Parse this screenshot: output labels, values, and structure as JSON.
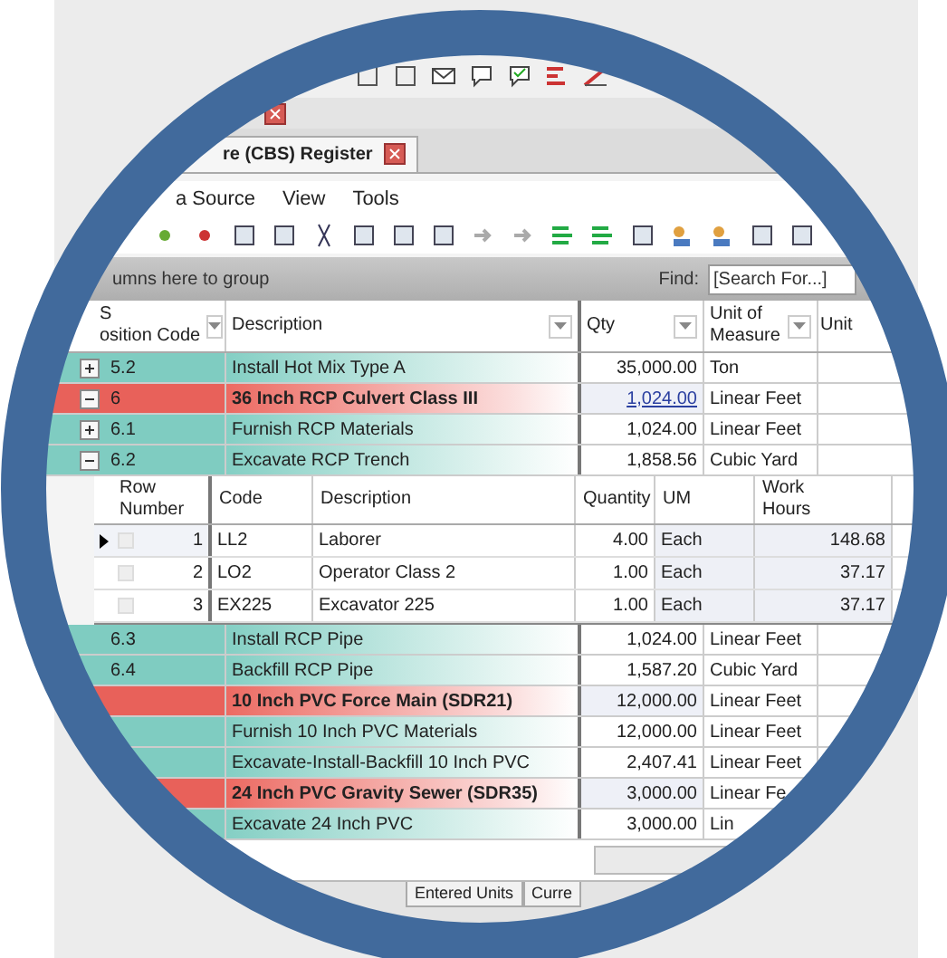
{
  "document_tab": {
    "label": "re (CBS) Register",
    "closable": true
  },
  "menu": [
    "a Source",
    "View",
    "Tools"
  ],
  "group_bar": {
    "hint": "umns here to group",
    "find_label": "Find:",
    "search_placeholder": "[Search For...]"
  },
  "table": {
    "columns": [
      "S\nosition Code",
      "Description",
      "Qty",
      "Unit of\nMeasure",
      "Unit"
    ],
    "rows": [
      {
        "kind": "item",
        "code": "5.2",
        "expanded": false,
        "description": "Install Hot Mix Type A",
        "qty": "35,000.00",
        "qty_link": false,
        "um": "Ton"
      },
      {
        "kind": "heading",
        "code": "6",
        "expanded": true,
        "description": "36 Inch RCP Culvert Class III",
        "qty": "1,024.00",
        "qty_link": true,
        "um": "Linear Feet"
      },
      {
        "kind": "item",
        "code": "6.1",
        "expanded": false,
        "description": "Furnish RCP Materials",
        "qty": "1,024.00",
        "qty_link": false,
        "um": "Linear Feet"
      },
      {
        "kind": "item",
        "code": "6.2",
        "expanded": true,
        "description": "Excavate RCP Trench",
        "qty": "1,858.56",
        "qty_link": false,
        "um": "Cubic Yard",
        "details": {
          "columns": [
            "Row\nNumber",
            "Code",
            "Description",
            "Quantity",
            "UM",
            "Work\nHours"
          ],
          "rows": [
            {
              "row_number": "1",
              "code": "LL2",
              "description": "Laborer",
              "quantity": "4.00",
              "um": "Each",
              "work_hours": "148.68",
              "selected": true
            },
            {
              "row_number": "2",
              "code": "LO2",
              "description": "Operator Class 2",
              "quantity": "1.00",
              "um": "Each",
              "work_hours": "37.17",
              "selected": false
            },
            {
              "row_number": "3",
              "code": "EX225",
              "description": "Excavator 225",
              "quantity": "1.00",
              "um": "Each",
              "work_hours": "37.17",
              "selected": false
            }
          ]
        }
      },
      {
        "kind": "item",
        "code": "6.3",
        "description": "Install RCP Pipe",
        "qty": "1,024.00",
        "qty_link": false,
        "um": "Linear Feet"
      },
      {
        "kind": "item",
        "code": "6.4",
        "description": "Backfill RCP Pipe",
        "qty": "1,587.20",
        "qty_link": false,
        "um": "Cubic Yard"
      },
      {
        "kind": "heading",
        "description": "10 Inch PVC Force Main (SDR21)",
        "qty": "12,000.00",
        "qty_link": false,
        "um": "Linear Feet"
      },
      {
        "kind": "item",
        "description": "Furnish 10 Inch PVC Materials",
        "qty": "12,000.00",
        "qty_link": false,
        "um": "Linear Feet"
      },
      {
        "kind": "item",
        "description": "Excavate-Install-Backfill 10 Inch PVC",
        "qty": "2,407.41",
        "qty_link": false,
        "um": "Linear Feet"
      },
      {
        "kind": "heading",
        "description": "24 Inch PVC Gravity Sewer (SDR35)",
        "qty": "3,000.00",
        "qty_link": false,
        "um": "Linear Fe"
      },
      {
        "kind": "item",
        "description": "Excavate 24 Inch PVC",
        "qty": "3,000.00",
        "qty_link": false,
        "um": "Lin"
      }
    ]
  },
  "status_tabs": [
    "Entered Units",
    "Curre"
  ]
}
